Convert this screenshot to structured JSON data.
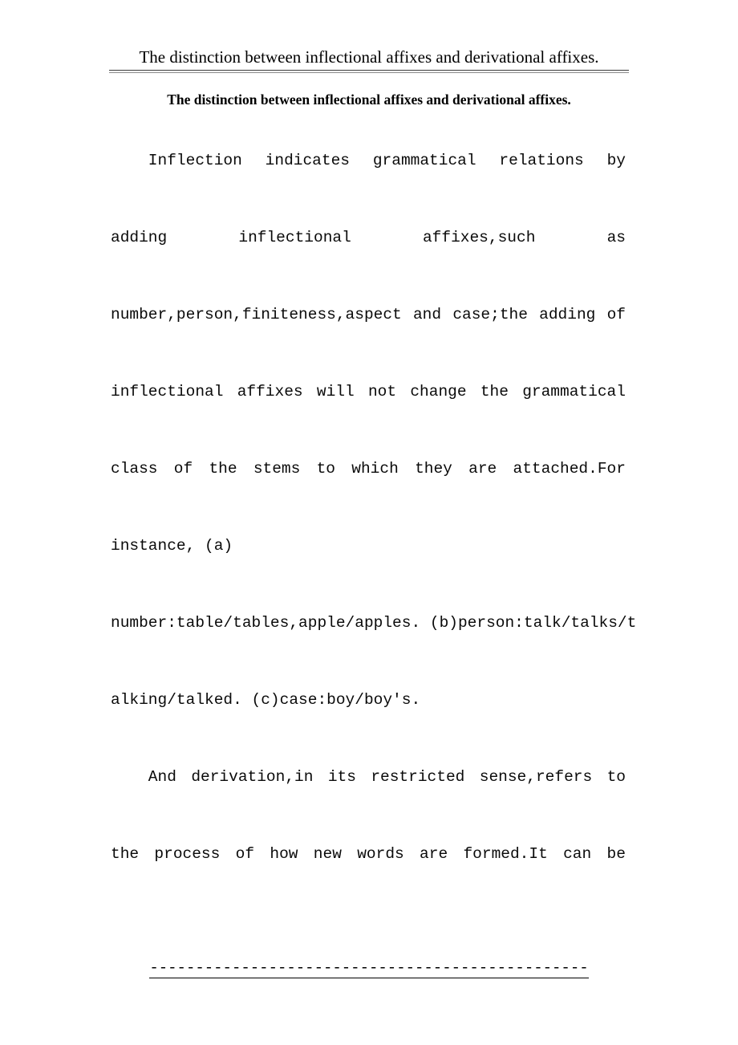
{
  "document": {
    "running_header": {
      "text": "The distinction between inflectional affixes and derivational affixes."
    },
    "title": "The distinction between inflectional affixes and derivational affixes.",
    "body": {
      "paragraphs": [
        {
          "id": "paragraph-inflection",
          "lines": [
            {
              "justified": true,
              "segments": [
                "    Inflection",
                "indicates",
                "grammatical",
                "relations",
                "by"
              ],
              "text": "    Inflection indicates grammatical relations by"
            },
            {
              "justified": true,
              "segments": [
                "adding",
                "inflectional",
                "affixes,such",
                "as"
              ],
              "text": "adding inflectional affixes,such as"
            },
            {
              "justified": true,
              "segments": [
                "number,person,finiteness,aspect",
                "and",
                "case;the",
                "adding",
                "of"
              ],
              "text": "number,person,finiteness,aspect and case;the adding of"
            },
            {
              "justified": true,
              "segments": [
                "inflectional",
                "affixes",
                "will",
                "not",
                "change",
                "the",
                "grammatical"
              ],
              "text": "inflectional affixes will not change the grammatical"
            },
            {
              "justified": true,
              "segments": [
                "class",
                "of",
                "the",
                "stems",
                "to",
                "which",
                "they",
                "are",
                "attached.For"
              ],
              "text": "class of the stems to which they are attached.For"
            },
            {
              "justified": false,
              "text": "instance, (a)"
            },
            {
              "justified": false,
              "text": "number:table/tables,apple/apples. (b)person:talk/talks/t"
            },
            {
              "justified": false,
              "text": "alking/talked. (c)case:boy/boy's."
            }
          ]
        },
        {
          "id": "paragraph-derivation",
          "lines": [
            {
              "justified": true,
              "segments": [
                "    And",
                "derivation,in",
                "its",
                "restricted",
                "sense,refers",
                "to"
              ],
              "text": "    And derivation,in its restricted sense,refers to"
            },
            {
              "justified": true,
              "segments": [
                "the",
                "process",
                "of",
                "how",
                "new",
                "words",
                "are",
                "formed.It",
                "can",
                "be"
              ],
              "text": "the process of how new words are formed.It can be"
            }
          ]
        }
      ]
    },
    "footer": {
      "separator": "------------------------------------------------"
    }
  }
}
